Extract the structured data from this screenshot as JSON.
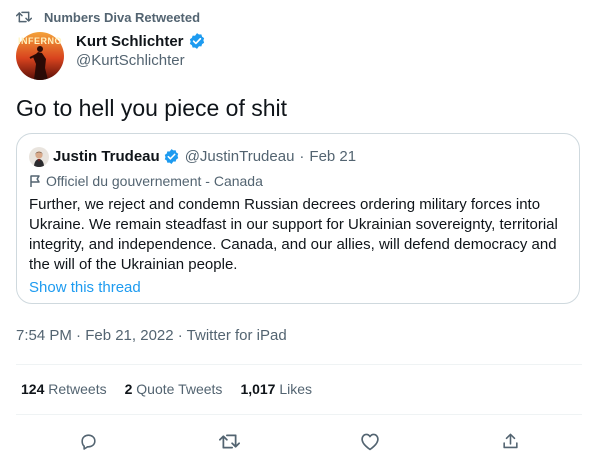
{
  "retweet_bar": {
    "label": "Numbers Diva Retweeted",
    "icon": "retweet-icon"
  },
  "tweet": {
    "author": {
      "name": "Kurt Schlichter",
      "handle": "@KurtSchlichter",
      "verified": true,
      "avatar_text": "INFERNO"
    },
    "text": "Go to hell you piece of shit"
  },
  "quoted_tweet": {
    "author": {
      "name": "Justin Trudeau",
      "handle": "@JustinTrudeau",
      "verified": true
    },
    "separator": "·",
    "date": "Feb 21",
    "label": "Officiel du gouvernement - Canada",
    "text": "Further, we reject and condemn Russian decrees ordering military forces into Ukraine. We remain steadfast in our support for Ukrainian sovereignty, territorial integrity, and independence. Canada, and our allies, will defend democracy and the will of the Ukrainian people.",
    "show_thread": "Show this thread"
  },
  "timestamp": "7:54 PM · Feb 21, 2022 · Twitter for iPad",
  "stats": {
    "retweets": {
      "count": "124",
      "label": "Retweets"
    },
    "quote_tweets": {
      "count": "2",
      "label": "Quote Tweets"
    },
    "likes": {
      "count": "1,017",
      "label": "Likes"
    }
  },
  "actions": [
    "reply-icon",
    "retweet-icon",
    "like-icon",
    "share-icon"
  ],
  "colors": {
    "text": "#0f1419",
    "muted": "#536471",
    "accent": "#1d9bf0",
    "border": "#cfd9de"
  }
}
